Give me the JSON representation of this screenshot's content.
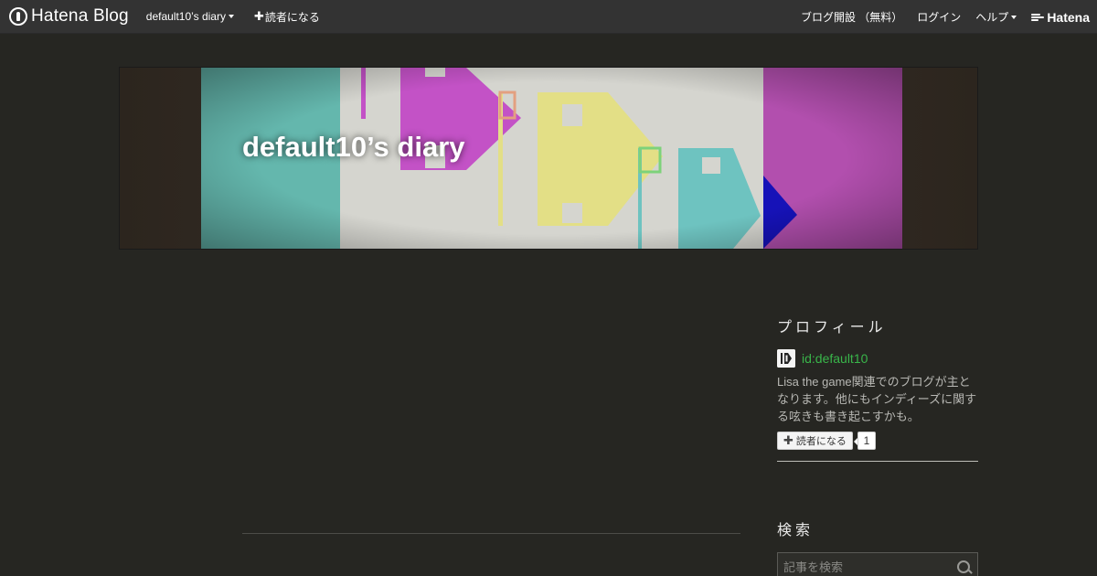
{
  "topbar": {
    "brand": "Hatena Blog",
    "blog_menu": "default10’s diary",
    "subscribe": "読者になる",
    "links": {
      "open_blog": "ブログ開設 （無料）",
      "login": "ログイン",
      "help": "ヘルプ"
    },
    "hatena": "Hatena"
  },
  "header": {
    "title": "default10’s diary"
  },
  "sidebar": {
    "profile": {
      "title": "プロフィール",
      "id": "id:default10",
      "description": "Lisa the game関連でのブログが主となります。他にもインディーズに関する呟きも書き起こすかも。",
      "subscribe_label": "読者になる",
      "subscriber_count": "1"
    },
    "search": {
      "title": "検索",
      "placeholder": "記事を検索"
    }
  },
  "colors": {
    "page_bg": "#262622",
    "topbar_bg": "#333333",
    "link_green": "#39b54a"
  }
}
